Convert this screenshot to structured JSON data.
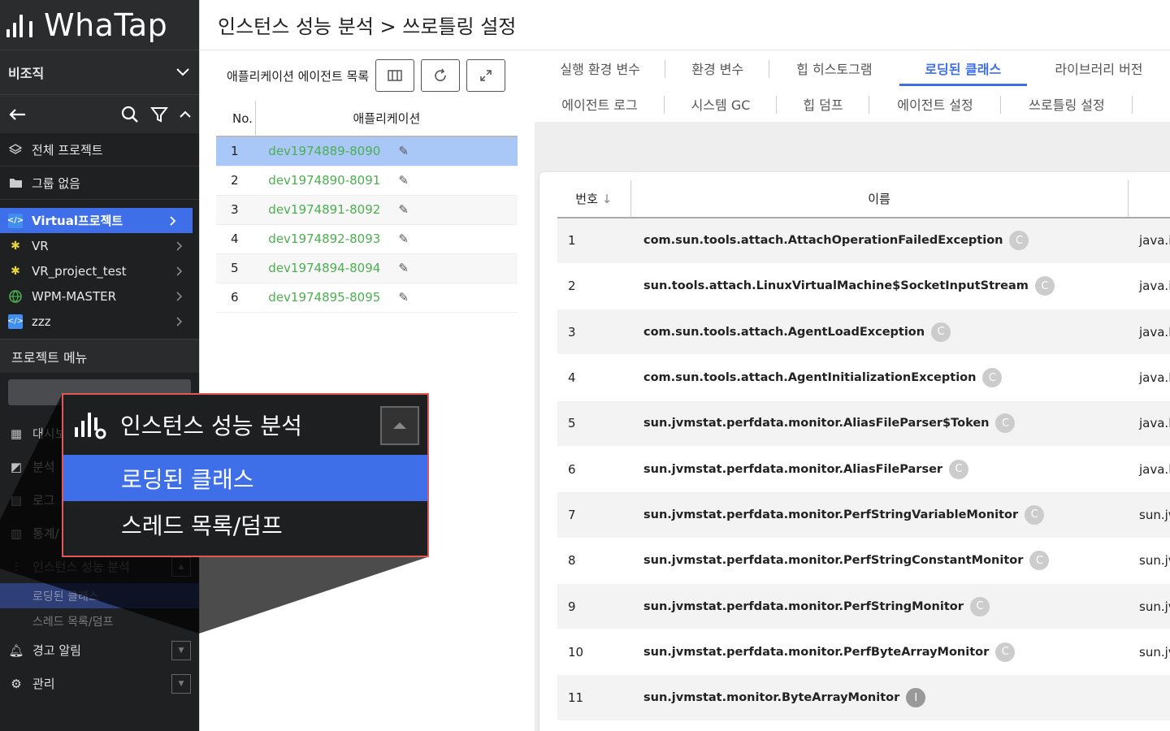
{
  "sidebar": {
    "logo_text": "WhaTap",
    "org_label": "비조직",
    "folders": [
      {
        "label": "전체 프로젝트",
        "icon": "layers-icon"
      },
      {
        "label": "그룹 없음",
        "icon": "folder-icon"
      }
    ],
    "projects": [
      {
        "label": "Virtual프로젝트",
        "icon": "code-icon",
        "color": "#3f8ef0"
      },
      {
        "label": "VR",
        "icon": "puzzle-icon",
        "color": "#e8d33a"
      },
      {
        "label": "VR_project_test",
        "icon": "puzzle-icon",
        "color": "#e8d33a"
      },
      {
        "label": "WPM-MASTER",
        "icon": "globe-icon",
        "color": "#4caf50"
      },
      {
        "label": "zzz",
        "icon": "code-icon",
        "color": "#3f8ef0"
      }
    ],
    "project_menu_title": "프로젝트 메뉴",
    "menu": [
      {
        "label": "대시보",
        "icon": "grid-icon"
      },
      {
        "label": "분석",
        "icon": "chart-icon"
      },
      {
        "label": "로그",
        "icon": "log-icon"
      },
      {
        "label": "통계/",
        "icon": "stats-icon"
      },
      {
        "label": "인스턴스 성능 분석",
        "icon": "instance-icon"
      }
    ],
    "submenu": [
      "로딩된 클래스",
      "스레드 목록/덤프"
    ],
    "bottom": [
      {
        "label": "경고 알림",
        "icon": "bell-icon"
      },
      {
        "label": "관리",
        "icon": "gear-icon"
      }
    ]
  },
  "zoom": {
    "title": "인스턴스 성능 분석",
    "items": [
      "로딩된 클래스",
      "스레드 목록/덤프"
    ]
  },
  "page": {
    "title": "인스턴스 성능 분석 > 쓰로틀링 설정"
  },
  "agents": {
    "title": "애플리케이션 에이전트 목록",
    "col_no": "No.",
    "col_app": "애플리케이션",
    "rows": [
      {
        "no": "1",
        "app": "dev1974889-8090"
      },
      {
        "no": "2",
        "app": "dev1974890-8091"
      },
      {
        "no": "3",
        "app": "dev1974891-8092"
      },
      {
        "no": "4",
        "app": "dev1974892-8093"
      },
      {
        "no": "5",
        "app": "dev1974894-8094"
      },
      {
        "no": "6",
        "app": "dev1974895-8095"
      }
    ]
  },
  "tabs": {
    "row1": [
      "실행 환경 변수",
      "환경 변수",
      "힙 히스토그램",
      "로딩된 클래스",
      "라이브러리 버전"
    ],
    "row2": [
      "에이전트 로그",
      "시스템 GC",
      "힙 덤프",
      "에이전트 설정",
      "쓰로틀링 설정"
    ],
    "active": "로딩된 클래스"
  },
  "classes": {
    "col_num": "번호",
    "col_name": "이름",
    "rows": [
      {
        "num": "1",
        "name": "com.sun.tools.attach.AttachOperationFailedException",
        "badge": "C",
        "pkg": "java.io"
      },
      {
        "num": "2",
        "name": "sun.tools.attach.LinuxVirtualMachine$SocketInputStream",
        "badge": "C",
        "pkg": "java.io"
      },
      {
        "num": "3",
        "name": "com.sun.tools.attach.AgentLoadException",
        "badge": "C",
        "pkg": "java.la"
      },
      {
        "num": "4",
        "name": "com.sun.tools.attach.AgentInitializationException",
        "badge": "C",
        "pkg": "java.la"
      },
      {
        "num": "5",
        "name": "sun.jvmstat.perfdata.monitor.AliasFileParser$Token",
        "badge": "C",
        "pkg": "java.la"
      },
      {
        "num": "6",
        "name": "sun.jvmstat.perfdata.monitor.AliasFileParser",
        "badge": "C",
        "pkg": "java.la"
      },
      {
        "num": "7",
        "name": "sun.jvmstat.perfdata.monitor.PerfStringVariableMonitor",
        "badge": "C",
        "pkg": "sun.jv"
      },
      {
        "num": "8",
        "name": "sun.jvmstat.perfdata.monitor.PerfStringConstantMonitor",
        "badge": "C",
        "pkg": "sun.jv"
      },
      {
        "num": "9",
        "name": "sun.jvmstat.perfdata.monitor.PerfStringMonitor",
        "badge": "C",
        "pkg": "sun.jv"
      },
      {
        "num": "10",
        "name": "sun.jvmstat.perfdata.monitor.PerfByteArrayMonitor",
        "badge": "C",
        "pkg": "sun.jv"
      },
      {
        "num": "11",
        "name": "sun.jvmstat.monitor.ByteArrayMonitor",
        "badge": "I",
        "pkg": ""
      }
    ]
  },
  "colors": {
    "accent": "#3f6fe8",
    "app_link": "#4caf50",
    "selected_row": "#a9c7f7",
    "highlight_border": "#e05858"
  }
}
